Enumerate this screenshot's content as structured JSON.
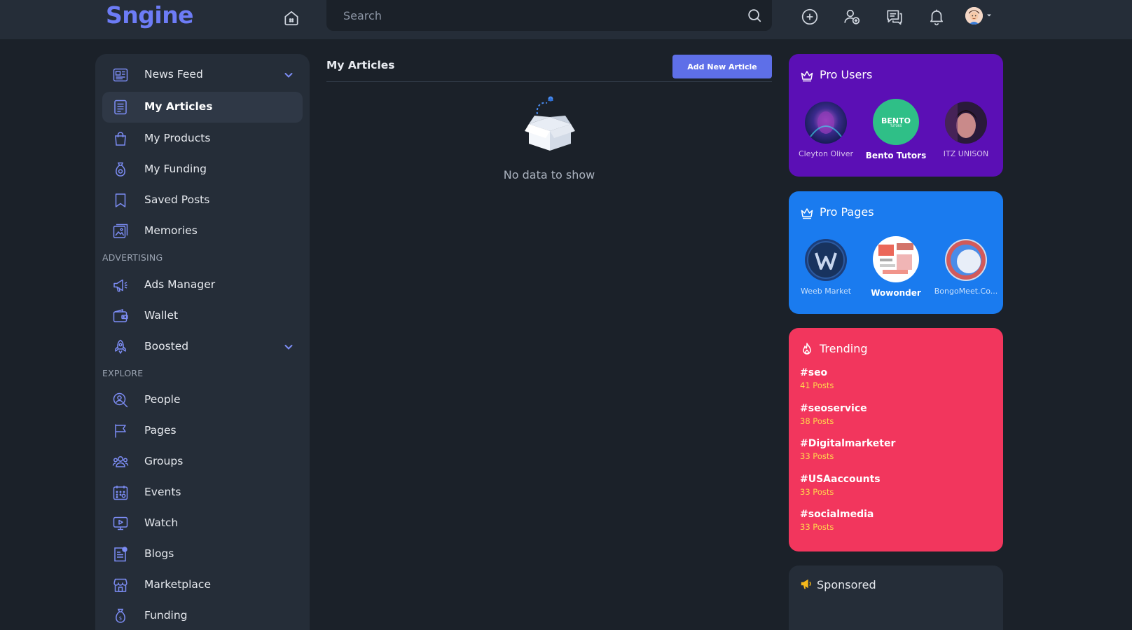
{
  "brand": {
    "logo": "Sngine"
  },
  "header": {
    "search_placeholder": "Search"
  },
  "sidebar": {
    "items": [
      {
        "label": "News Feed",
        "icon": "newspaper-icon",
        "has_chevron": true
      },
      {
        "label": "My Articles",
        "icon": "document-icon",
        "active": true
      },
      {
        "label": "My Products",
        "icon": "shopping-bag-icon"
      },
      {
        "label": "My Funding",
        "icon": "money-bag-icon"
      },
      {
        "label": "Saved Posts",
        "icon": "bookmark-icon"
      },
      {
        "label": "Memories",
        "icon": "photo-album-icon"
      }
    ],
    "advertising_label": "ADVERTISING",
    "advertising": [
      {
        "label": "Ads Manager",
        "icon": "megaphone-icon"
      },
      {
        "label": "Wallet",
        "icon": "wallet-icon"
      },
      {
        "label": "Boosted",
        "icon": "rocket-icon",
        "has_chevron": true
      }
    ],
    "explore_label": "EXPLORE",
    "explore": [
      {
        "label": "People",
        "icon": "people-search-icon"
      },
      {
        "label": "Pages",
        "icon": "flag-icon"
      },
      {
        "label": "Groups",
        "icon": "groups-icon"
      },
      {
        "label": "Events",
        "icon": "calendar-icon"
      },
      {
        "label": "Watch",
        "icon": "video-icon"
      },
      {
        "label": "Blogs",
        "icon": "blog-icon"
      },
      {
        "label": "Marketplace",
        "icon": "store-icon"
      },
      {
        "label": "Funding",
        "icon": "money-bag-icon"
      }
    ]
  },
  "main": {
    "title": "My Articles",
    "add_button": "Add New Article",
    "empty_text": "No data to show"
  },
  "pro_users": {
    "title": "Pro Users",
    "color": "#5b0fb5",
    "users": [
      {
        "name": "Cleyton Oliver"
      },
      {
        "name": "Bento Tutors",
        "featured": true,
        "logo_text": "BENTO",
        "logo_sub": "TUTORS"
      },
      {
        "name": "ITZ UNISON"
      }
    ]
  },
  "pro_pages": {
    "title": "Pro Pages",
    "color": "#1a7bef",
    "pages": [
      {
        "name": "Weeb Market"
      },
      {
        "name": "Wowonder",
        "featured": true
      },
      {
        "name": "BongoMeet.Co..."
      }
    ]
  },
  "trending": {
    "title": "Trending",
    "color": "#f2365d",
    "items": [
      {
        "tag": "#seo",
        "count": "41 Posts"
      },
      {
        "tag": "#seoservice",
        "count": "38 Posts"
      },
      {
        "tag": "#Digitalmarketer",
        "count": "33 Posts"
      },
      {
        "tag": "#USAaccounts",
        "count": "33 Posts"
      },
      {
        "tag": "#socialmedia",
        "count": "33 Posts"
      }
    ]
  },
  "sponsored": {
    "title": "Sponsored"
  }
}
